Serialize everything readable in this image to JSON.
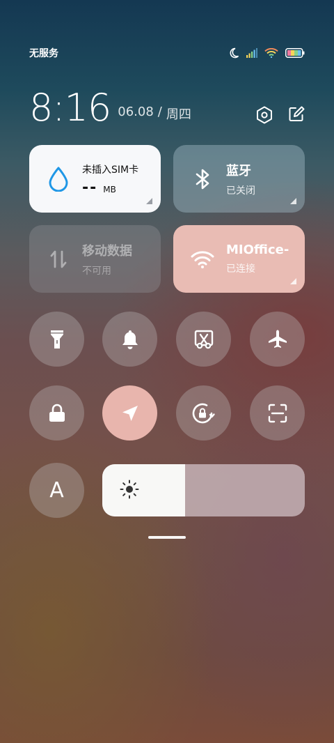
{
  "status_bar": {
    "carrier": "无服务",
    "icons": [
      "moon-icon",
      "signal-icon",
      "wifi-icon",
      "battery-icon"
    ]
  },
  "header": {
    "time": "8:16",
    "date": "06.08",
    "separator": "/",
    "weekday": "周四",
    "actions": [
      "settings-icon",
      "edit-icon"
    ]
  },
  "tiles": {
    "sim": {
      "title": "未插入SIM卡",
      "value": "--",
      "unit": "MB",
      "icon": "water-drop-icon",
      "active": true
    },
    "bluetooth": {
      "title": "蓝牙",
      "status": "已关闭",
      "icon": "bluetooth-icon",
      "active": false
    },
    "mobile_data": {
      "title": "移动数据",
      "status": "不可用",
      "icon": "data-arrows-icon",
      "disabled": true
    },
    "wifi": {
      "title": "MIOffice-",
      "status": "已连接",
      "icon": "wifi-icon",
      "active": true
    }
  },
  "toggles_row1": [
    {
      "name": "flashlight",
      "icon": "flashlight-icon",
      "active": false
    },
    {
      "name": "ringer",
      "icon": "bell-icon",
      "active": false
    },
    {
      "name": "screenshot",
      "icon": "scissors-icon",
      "active": false
    },
    {
      "name": "airplane",
      "icon": "airplane-icon",
      "active": false
    }
  ],
  "toggles_row2": [
    {
      "name": "lock-screen",
      "icon": "lock-icon",
      "active": false
    },
    {
      "name": "location",
      "icon": "location-arrow-icon",
      "active": true
    },
    {
      "name": "rotation-lock",
      "icon": "rotation-lock-icon",
      "active": false
    },
    {
      "name": "scanner",
      "icon": "scan-icon",
      "active": false
    }
  ],
  "auto_brightness": {
    "label": "A",
    "active": false
  },
  "brightness": {
    "level": 0.41,
    "icon": "sun-icon"
  },
  "colors": {
    "active_tile": "#e9bcb4",
    "sim_tile": "#f7f8fa",
    "accent_blue": "#1f97e6"
  }
}
